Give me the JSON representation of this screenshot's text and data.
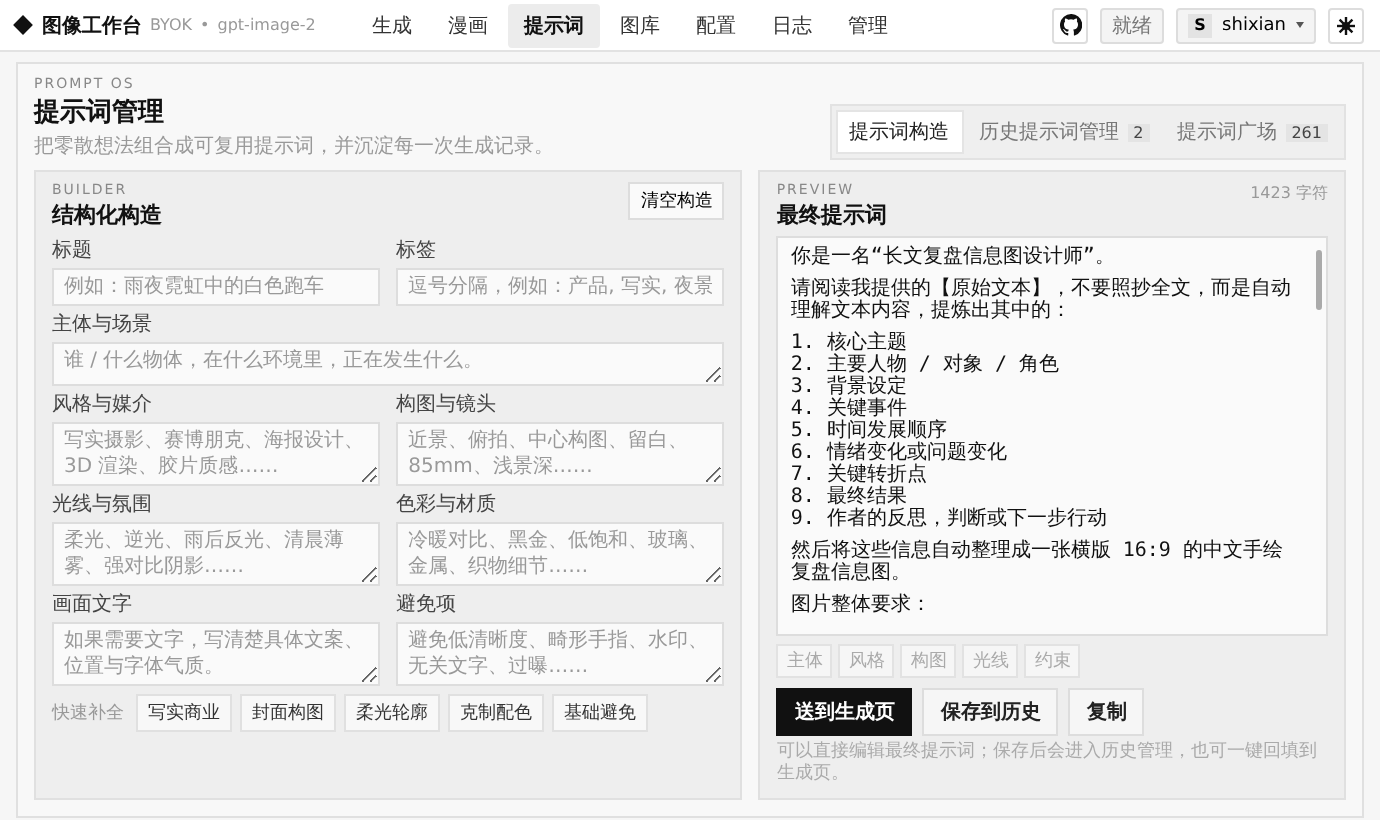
{
  "app": {
    "logo": "图像工作台",
    "tag": "BYOK",
    "separator": "•",
    "model": "gpt-image-2"
  },
  "nav": [
    {
      "label": "生成",
      "selected": false
    },
    {
      "label": "漫画",
      "selected": false
    },
    {
      "label": "提示词",
      "selected": true
    },
    {
      "label": "图库",
      "selected": false
    },
    {
      "label": "配置",
      "selected": false
    },
    {
      "label": "日志",
      "selected": false
    },
    {
      "label": "管理",
      "selected": false
    }
  ],
  "status": "就绪",
  "user": {
    "initial": "S",
    "name": "shixian"
  },
  "page": {
    "eyebrow": "PROMPT OS",
    "title": "提示词管理",
    "subtitle": "把零散想法组合成可复用提示词，并沉淀每一次生成记录。"
  },
  "tabs": [
    {
      "label": "提示词构造",
      "selected": true
    },
    {
      "label": "历史提示词管理",
      "count": "2",
      "selected": false
    },
    {
      "label": "提示词广场",
      "count": "261",
      "selected": false
    }
  ],
  "builder": {
    "eyebrow": "BUILDER",
    "title": "结构化构造",
    "clear_button": "清空构造",
    "fields": [
      {
        "kind": "line",
        "label": "标题",
        "placeholder": "例如：雨夜霓虹中的白色跑车"
      },
      {
        "kind": "line",
        "label": "标签",
        "placeholder": "逗号分隔，例如：产品, 写实, 夜景"
      },
      {
        "kind": "wide",
        "label": "主体与场景",
        "placeholder": "谁 / 什么物体，在什么环境里，正在发生什么。"
      },
      {
        "kind": "area",
        "label": "风格与媒介",
        "placeholder": "写实摄影、赛博朋克、海报设计、3D 渲染、胶片质感……"
      },
      {
        "kind": "area",
        "label": "构图与镜头",
        "placeholder": "近景、俯拍、中心构图、留白、85mm、浅景深……"
      },
      {
        "kind": "area",
        "label": "光线与氛围",
        "placeholder": "柔光、逆光、雨后反光、清晨薄雾、强对比阴影……"
      },
      {
        "kind": "area",
        "label": "色彩与材质",
        "placeholder": "冷暖对比、黑金、低饱和、玻璃、金属、织物细节……"
      },
      {
        "kind": "area",
        "label": "画面文字",
        "placeholder": "如果需要文字，写清楚具体文案、位置与字体气质。"
      },
      {
        "kind": "area",
        "label": "避免项",
        "placeholder": "避免低清晰度、畸形手指、水印、无关文字、过曝……"
      }
    ],
    "quick_label": "快速补全",
    "presets": [
      "写实商业",
      "封面构图",
      "柔光轮廓",
      "克制配色",
      "基础避免"
    ]
  },
  "preview": {
    "eyebrow": "PREVIEW",
    "count": "1423 字符",
    "title": "最终提示词",
    "paragraphs": [
      {
        "lines": [
          "你是一名“长文复盘信息图设计师”。"
        ]
      },
      {
        "lines": [
          "请阅读我提供的【原始文本】，不要照抄全文，而是自动理解文本内容，提炼出其中的："
        ]
      },
      {
        "lines": [
          "1. 核心主题",
          "2. 主要人物 / 对象 / 角色",
          "3. 背景设定",
          "4. 关键事件",
          "5. 时间发展顺序",
          "6. 情绪变化或问题变化",
          "7. 关键转折点",
          "8. 最终结果",
          "9. 作者的反思，判断或下一步行动"
        ]
      },
      {
        "lines": [
          "然后将这些信息自动整理成一张横版 16:9 的中文手绘复盘信息图。"
        ]
      },
      {
        "lines": [
          "图片整体要求："
        ]
      }
    ],
    "chips": [
      {
        "label": "主体",
        "disabled": true
      },
      {
        "label": "风格",
        "disabled": true
      },
      {
        "label": "构图",
        "disabled": true
      },
      {
        "label": "光线",
        "disabled": true
      },
      {
        "label": "约束",
        "disabled": true
      }
    ],
    "buttons": [
      {
        "label": "送到生成页",
        "kind": "primary"
      },
      {
        "label": "保存到历史",
        "kind": "plain"
      },
      {
        "label": "复制",
        "kind": "plain"
      }
    ],
    "note": "可以直接编辑最终提示词；保存后会进入历史管理，也可一键回填到生成页。"
  }
}
